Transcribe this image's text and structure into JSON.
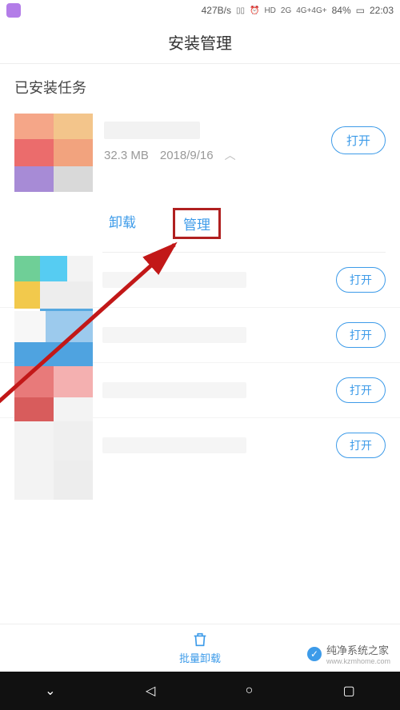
{
  "status_bar": {
    "speed": "427B/s",
    "vibrate_icon": "vibrate",
    "alarm_icon": "alarm",
    "hd_icon": "HD",
    "net1": "2G",
    "net2": "4G+4G+",
    "battery_pct": "84%",
    "time": "22:03"
  },
  "header": {
    "title": "安装管理"
  },
  "section": {
    "installed_label": "已安装任务"
  },
  "app1": {
    "size": "32.3 MB",
    "date": "2018/9/16",
    "open": "打开",
    "uninstall": "卸载",
    "manage": "管理"
  },
  "open_label": "打开",
  "bottom": {
    "batch_uninstall": "批量卸载"
  },
  "watermark": {
    "name": "纯净系统之家",
    "url": "www.kzmhome.com"
  }
}
